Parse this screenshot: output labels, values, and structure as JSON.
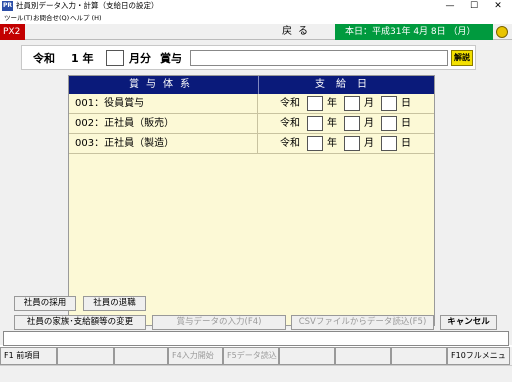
{
  "window": {
    "icon_text": "PR",
    "title": "社員別データ入力・計算（支給日の設定）",
    "minimize": "—",
    "maximize": "☐",
    "close": "✕"
  },
  "menu": [
    {
      "label": "ツール(T)"
    },
    {
      "label": "お問合せ(Q)"
    },
    {
      "label": "ヘルプ (H)"
    }
  ],
  "toolbar": {
    "px2": "PX2",
    "back": "戻る",
    "today": "本日：平成31年 4月 8日 （月）"
  },
  "header": {
    "era": "令和",
    "year": "1 年",
    "month_value": "",
    "month_label": "月分",
    "bonus_label": "賞与",
    "bonus_name": "",
    "help_button": "解説"
  },
  "grid": {
    "col_system": "賞与体系",
    "col_payday": "支給日",
    "rows": [
      {
        "name": "001：役員賞与",
        "era": "令和",
        "year": "",
        "year_label": "年",
        "month": "",
        "month_label": "月",
        "day": "",
        "day_label": "日"
      },
      {
        "name": "002：正社員（販売）",
        "era": "令和",
        "year": "",
        "year_label": "年",
        "month": "",
        "month_label": "月",
        "day": "",
        "day_label": "日"
      },
      {
        "name": "003：正社員（製造）",
        "era": "令和",
        "year": "",
        "year_label": "年",
        "month": "",
        "month_label": "月",
        "day": "",
        "day_label": "日"
      }
    ]
  },
  "buttons": {
    "hire": "社員の採用",
    "retire": "社員の退職",
    "family": "社員の家族･支給額等の変更",
    "bonus_input": "賞与データの入力(F4)",
    "csv_import": "CSVファイルからデータ読込(F5)",
    "cancel": "キャンセル"
  },
  "fkeys": {
    "f1": "F1 前項目",
    "f4": "F4入力開始",
    "f5": "F5データ読込",
    "f10": "F10フルメニュー"
  }
}
